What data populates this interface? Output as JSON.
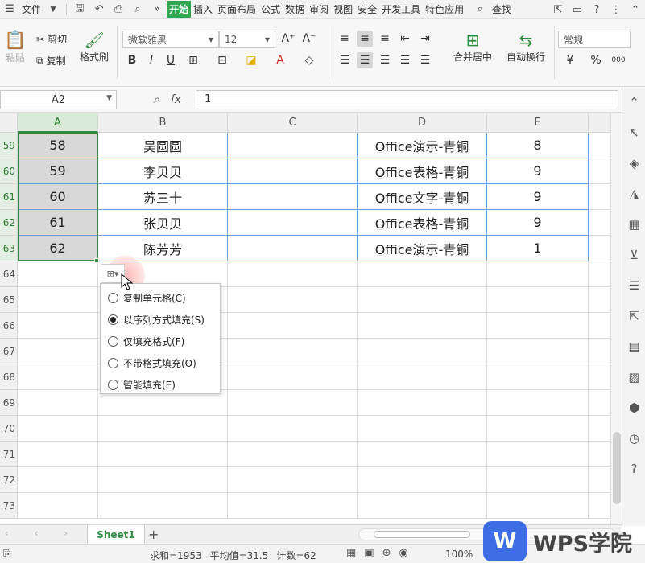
{
  "menubar": {
    "file": "文件",
    "tabs": [
      "开始",
      "插入",
      "页面布局",
      "公式",
      "数据",
      "审阅",
      "视图",
      "安全",
      "开发工具",
      "特色应用"
    ],
    "active_tab": "开始",
    "search": "查找"
  },
  "ribbon": {
    "paste": "粘贴",
    "cut": "剪切",
    "copy": "复制",
    "format_painter": "格式刷",
    "font_name": "微软雅黑",
    "font_size": "12",
    "merge_center": "合并居中",
    "wrap_text": "自动换行",
    "number_format": "常规",
    "bold": "B",
    "italic": "I",
    "underline": "U",
    "font_grow": "A⁺",
    "font_shrink": "A⁻",
    "font_color": "A",
    "percent": "%",
    "decimal": "000"
  },
  "formula_bar": {
    "name_box": "A2",
    "fx": "fx",
    "value": "1"
  },
  "columns": [
    "A",
    "B",
    "C",
    "D",
    "E"
  ],
  "row_numbers": [
    "59",
    "60",
    "61",
    "62",
    "63",
    "64",
    "65",
    "66",
    "67",
    "68",
    "69",
    "70",
    "71",
    "72",
    "73"
  ],
  "rows": [
    {
      "a": "58",
      "b": "吴圆圆",
      "c": "",
      "d": "Office演示-青铜",
      "e": "8"
    },
    {
      "a": "59",
      "b": "李贝贝",
      "c": "",
      "d": "Office表格-青铜",
      "e": "9"
    },
    {
      "a": "60",
      "b": "苏三十",
      "c": "",
      "d": "Office文字-青铜",
      "e": "9"
    },
    {
      "a": "61",
      "b": "张贝贝",
      "c": "",
      "d": "Office表格-青铜",
      "e": "9"
    },
    {
      "a": "62",
      "b": "陈芳芳",
      "c": "",
      "d": "Office演示-青铜",
      "e": "1"
    }
  ],
  "autofill_menu": {
    "options": [
      {
        "label": "复制单元格(C)",
        "checked": false
      },
      {
        "label": "以序列方式填充(S)",
        "checked": true
      },
      {
        "label": "仅填充格式(F)",
        "checked": false
      },
      {
        "label": "不带格式填充(O)",
        "checked": false
      },
      {
        "label": "智能填充(E)",
        "checked": false
      }
    ]
  },
  "sheet": {
    "tab": "Sheet1",
    "add": "+"
  },
  "status": {
    "sum": "求和=1953",
    "average": "平均值=31.5",
    "count": "计数=62",
    "zoom": "100%"
  },
  "watermark": {
    "logo": "W",
    "text": "WPS学院"
  },
  "colors": {
    "accent": "#2e8b3c",
    "selection_fill": "#d8d8d8",
    "table_border": "#6fa0d2",
    "brand_blue": "#3d6ee8"
  }
}
